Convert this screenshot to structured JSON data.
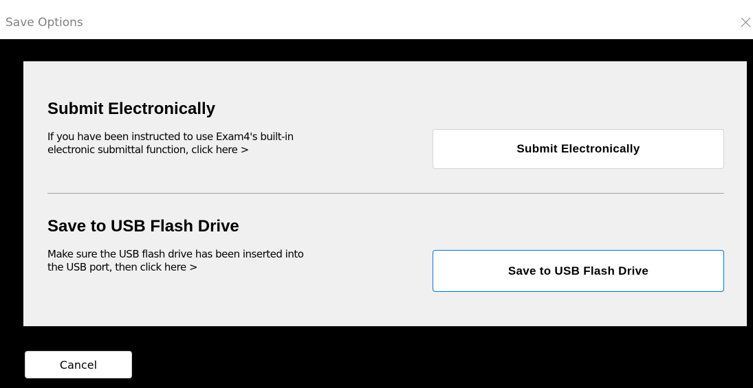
{
  "window": {
    "title": "Save Options",
    "close_icon": "close-icon"
  },
  "submit_section": {
    "heading": "Submit Electronically",
    "description_lines": [
      "If you have been instructed to use Exam4's built-in",
      "electronic submittal function, click here >"
    ],
    "button_label": "Submit Electronically"
  },
  "usb_section": {
    "heading": "Save to USB Flash Drive",
    "description_lines": [
      "Make sure the USB flash drive has been inserted into",
      "the USB port, then click here >"
    ],
    "button_label": "Save to USB Flash Drive"
  },
  "footer": {
    "cancel_label": "Cancel"
  },
  "colors": {
    "panel_background": "#f0f0f0",
    "client_background": "#000000",
    "focus_border": "#0078d4",
    "title_text": "#808080"
  }
}
